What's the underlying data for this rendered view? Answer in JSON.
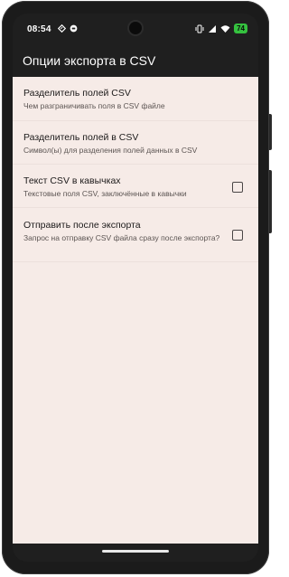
{
  "status_bar": {
    "time": "08:54",
    "battery": "74",
    "icons": [
      "location-diamond-icon",
      "circle-dot-icon",
      "vibrate-icon",
      "signal-icon",
      "wifi-icon",
      "battery-icon"
    ]
  },
  "app_bar": {
    "title": "Опции экспорта в CSV"
  },
  "settings": [
    {
      "title": "Разделитель полей CSV",
      "summary": "Чем разграничивать поля в CSV файле",
      "has_checkbox": false
    },
    {
      "title": "Разделитель полей в CSV",
      "summary": "Символ(ы) для разделения полей данных в CSV",
      "has_checkbox": false
    },
    {
      "title": "Текст CSV в кавычках",
      "summary": "Текстовые поля CSV, заключённые в кавычки",
      "has_checkbox": true,
      "checked": false
    },
    {
      "title": "Отправить после экспорта",
      "summary": "Запрос на отправку CSV файла сразу после экспорта?",
      "has_checkbox": true,
      "checked": false
    }
  ],
  "colors": {
    "content_background": "#f6ebe7",
    "app_bar_background": "#1f1f1f",
    "battery_green": "#35c23f"
  }
}
